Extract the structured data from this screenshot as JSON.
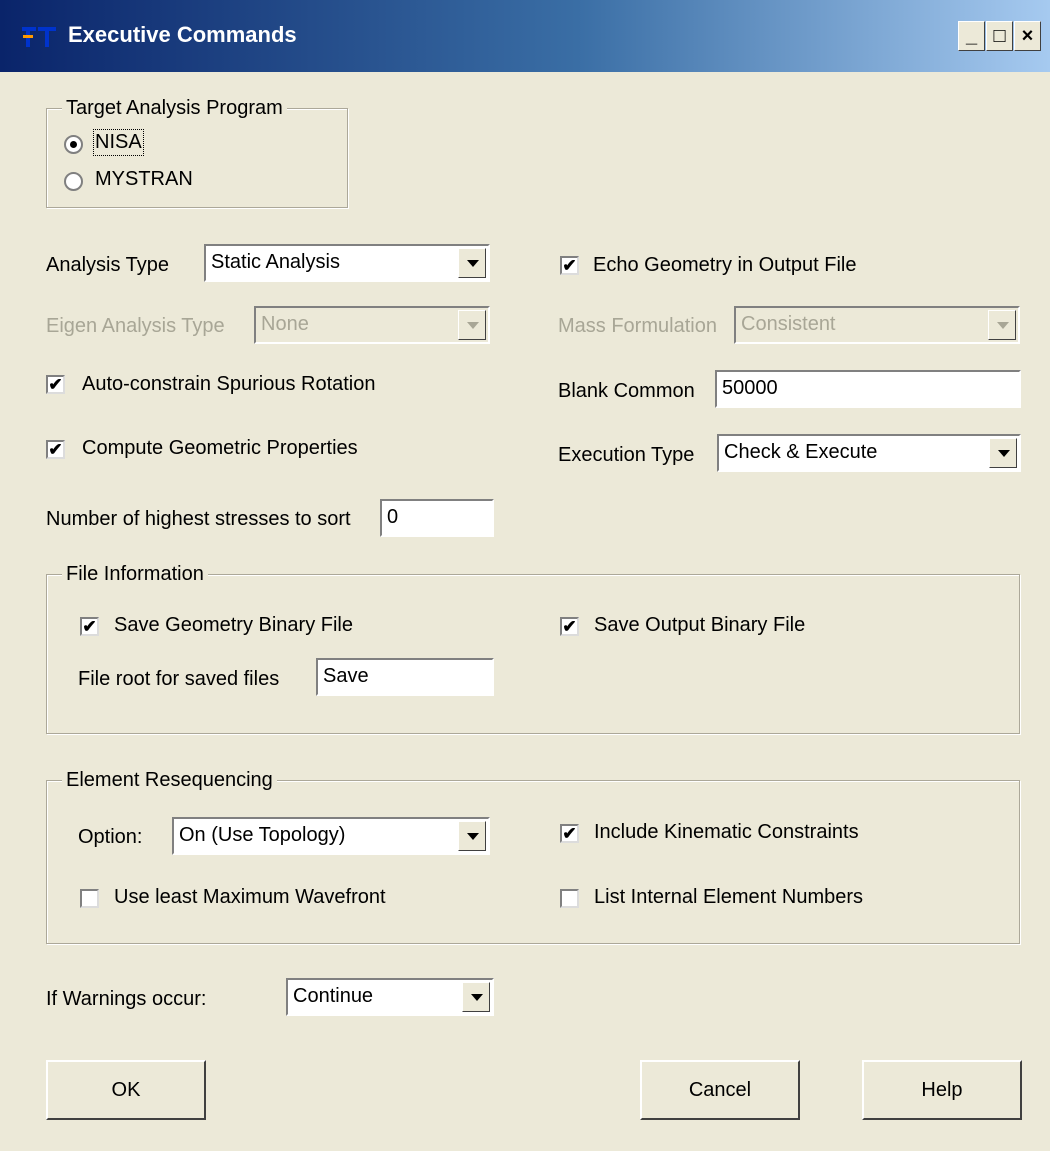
{
  "window": {
    "title": "Executive Commands",
    "controls": {
      "minimize": "_",
      "maximize": "□",
      "close": "×"
    }
  },
  "target_program": {
    "legend": "Target Analysis Program",
    "options": [
      {
        "label": "NISA",
        "selected": true
      },
      {
        "label": "MYSTRAN",
        "selected": false
      }
    ]
  },
  "analysis_type": {
    "label": "Analysis Type",
    "value": "Static Analysis"
  },
  "echo_geometry": {
    "label": "Echo Geometry in Output File",
    "checked": true
  },
  "eigen_analysis": {
    "label": "Eigen Analysis Type",
    "value": "None",
    "enabled": false
  },
  "mass_formulation": {
    "label": "Mass Formulation",
    "value": "Consistent",
    "enabled": false
  },
  "auto_constrain": {
    "label": "Auto-constrain Spurious Rotation",
    "checked": true
  },
  "blank_common": {
    "label": "Blank Common",
    "value": "50000"
  },
  "compute_geometric": {
    "label": "Compute Geometric Properties",
    "checked": true
  },
  "execution_type": {
    "label": "Execution Type",
    "value": "Check & Execute"
  },
  "highest_stresses": {
    "label": "Number of highest stresses to sort",
    "value": "0"
  },
  "file_info": {
    "legend": "File Information",
    "save_geometry": {
      "label": "Save Geometry Binary File",
      "checked": true
    },
    "save_output": {
      "label": "Save Output Binary File",
      "checked": true
    },
    "file_root": {
      "label": "File root for saved files",
      "value": "Save"
    }
  },
  "resequencing": {
    "legend": "Element Resequencing",
    "option": {
      "label": "Option:",
      "value": "On (Use Topology)"
    },
    "include_kinematic": {
      "label": "Include Kinematic Constraints",
      "checked": true
    },
    "least_wavefront": {
      "label": "Use least Maximum Wavefront",
      "checked": false
    },
    "list_internal": {
      "label": "List Internal Element Numbers",
      "checked": false
    }
  },
  "warnings": {
    "label": "If Warnings occur:",
    "value": "Continue"
  },
  "buttons": {
    "ok": "OK",
    "cancel": "Cancel",
    "help": "Help"
  },
  "check_mark": "✔"
}
